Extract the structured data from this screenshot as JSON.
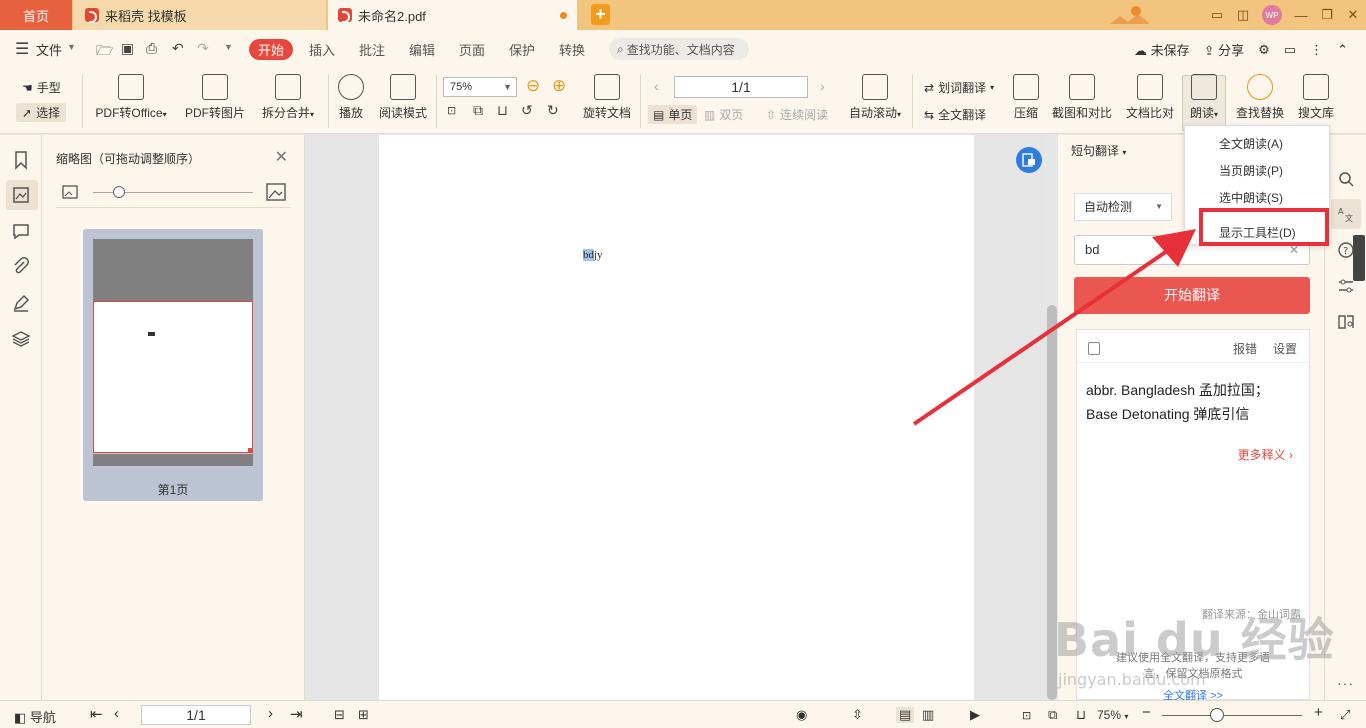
{
  "tabs": {
    "home": "首页",
    "template": "来稻壳 找模板",
    "document": "未命名2.pdf",
    "add": "+"
  },
  "window": {
    "avatar": "WP"
  },
  "menu": {
    "file": "文件",
    "start": "开始",
    "insert": "插入",
    "annotate": "批注",
    "edit": "编辑",
    "page": "页面",
    "protect": "保护",
    "convert": "转换",
    "search_placeholder": "查找功能、文档内容",
    "unsaved": "未保存",
    "share": "分享"
  },
  "toolbar": {
    "hand": "手型",
    "select": "选择",
    "pdf_to_office": "PDF转Office",
    "pdf_to_image": "PDF转图片",
    "split_merge": "拆分合并",
    "play": "播放",
    "read_mode": "阅读模式",
    "zoom": "75%",
    "rotate_doc": "旋转文档",
    "page_value": "1/1",
    "single_page": "单页",
    "double_page": "双页",
    "continuous": "连续阅读",
    "auto_scroll": "自动滚动",
    "word_translate": "划词翻译",
    "full_translate": "全文翻译",
    "compress": "压缩",
    "screenshot_compare": "截图和对比",
    "doc_compare": "文档比对",
    "read_aloud": "朗读",
    "find_replace": "查找替换",
    "search_lib": "搜文库"
  },
  "dropdown": {
    "items": [
      "全文朗读(A)",
      "当页朗读(P)",
      "选中朗读(S)",
      "显示工具栏(D)"
    ]
  },
  "thumbnail_panel": {
    "title": "缩略图（可拖动调整顺序）",
    "page_label": "第1页"
  },
  "document": {
    "selected": "bd",
    "rest": "jy"
  },
  "translate": {
    "title": "短句翻译",
    "lang": "自动检测",
    "input": "bd",
    "go": "开始翻译",
    "report": "报错",
    "settings": "设置",
    "meaning1": "abbr. Bangladesh 孟加拉国；",
    "meaning2": "Base Detonating 弹底引信",
    "more": "更多释义",
    "source": "翻译来源：金山词霸",
    "promo1": "建议使用全文翻译，支持更多语",
    "promo2": "言，保留文档原格式",
    "full_link": "全文翻译 >>"
  },
  "status": {
    "nav": "导航",
    "page": "1/1",
    "zoom": "75%"
  },
  "watermark": {
    "brand": "Bai du 经验",
    "url": "jingyan.baidu.com"
  },
  "colors": {
    "accent": "#e8473e",
    "tabbar": "#f3c47e",
    "highlight": "#e8303a",
    "link": "#2f7de1"
  }
}
